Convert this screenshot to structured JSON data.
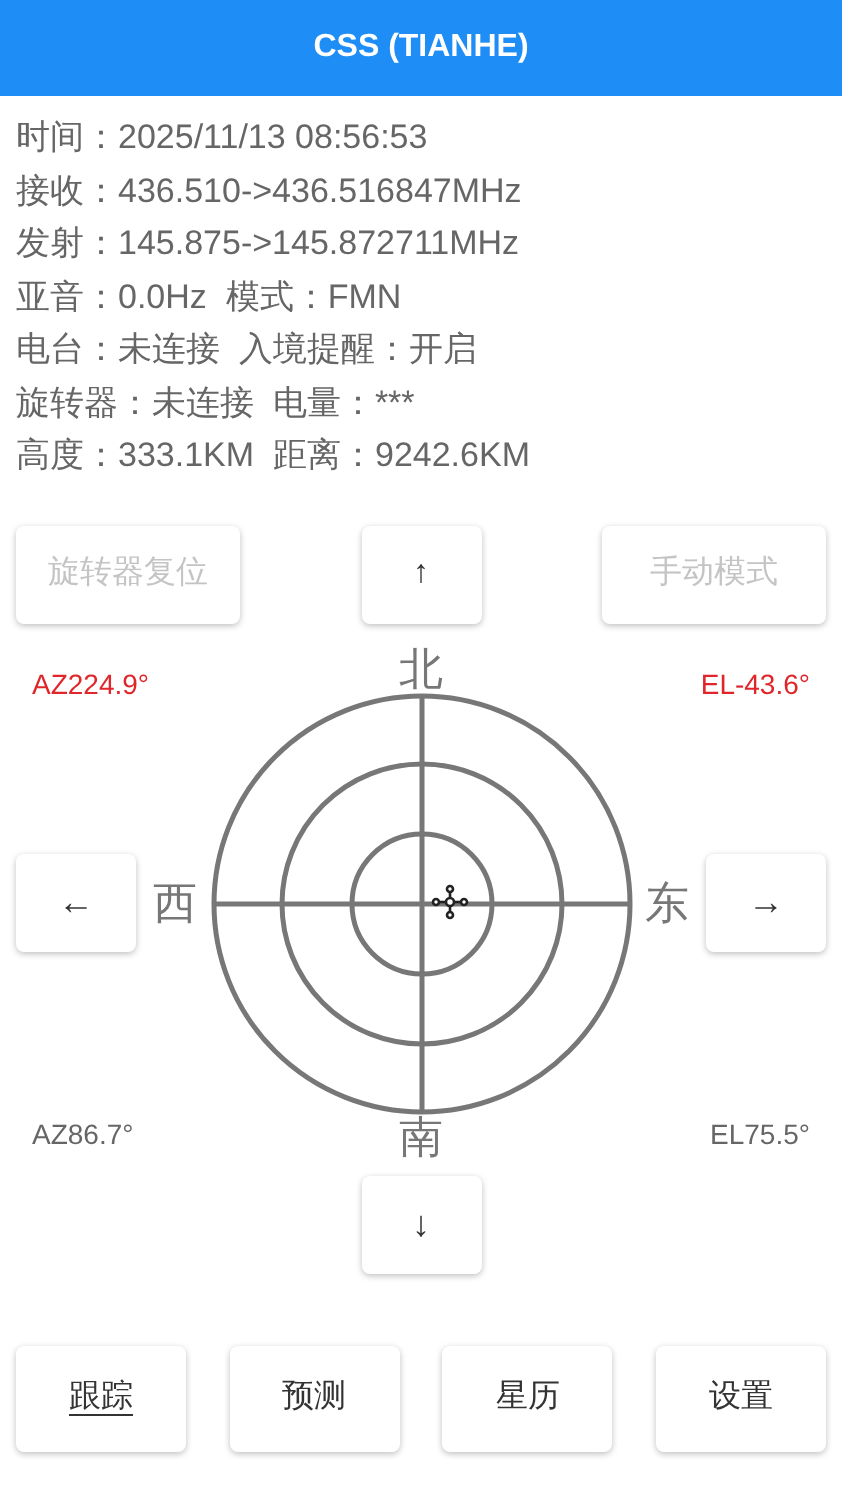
{
  "window": {
    "title": "CSS (TIANHE)"
  },
  "info_lines": [
    "时间：2025/11/13 08:56:53",
    "接收：436.510->436.516847MHz",
    "发射：145.875->145.872711MHz",
    "亚音：0.0Hz  模式：FMN",
    "电台：未连接  入境提醒：开启",
    "旋转器：未连接  电量：***",
    "高度：333.1KM  距离：9242.6KM"
  ],
  "top_controls": [
    {
      "kind": "button",
      "label": "旋转器复位",
      "disabled": true
    },
    {
      "kind": "arrow",
      "label": "↑",
      "disabled": false
    },
    {
      "kind": "button",
      "label": "手动模式",
      "disabled": true
    }
  ],
  "readings_top": [
    {
      "kind": "target",
      "text": "AZ224.9°"
    },
    {
      "kind": "target",
      "text": "EL-43.6°"
    }
  ],
  "compass": {
    "north": "北",
    "south": "南",
    "west": "西",
    "east": "东",
    "left_button": "←",
    "right_button": "→"
  },
  "readings_bottom": [
    {
      "kind": "current",
      "text": "AZ86.7°"
    },
    {
      "kind": "current",
      "text": "EL75.5°"
    }
  ],
  "down_button": "↓",
  "tabs": [
    {
      "label": "跟踪",
      "selected": true
    },
    {
      "label": "预测",
      "selected": false
    },
    {
      "label": "星历",
      "selected": false
    },
    {
      "label": "设置",
      "selected": false
    }
  ]
}
